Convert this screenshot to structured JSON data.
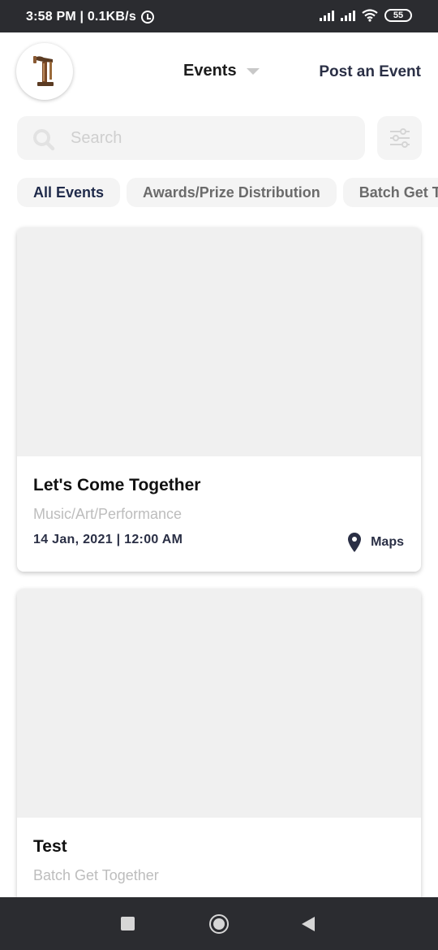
{
  "status_bar": {
    "time_speed": "3:58 PM | 0.1KB/s",
    "battery": "55"
  },
  "header": {
    "title": "Events",
    "post_link": "Post an Event",
    "logo_icon": "hammer-stand-logo"
  },
  "search": {
    "placeholder": "Search",
    "value": ""
  },
  "categories": [
    "All Events",
    "Awards/Prize Distribution",
    "Batch Get Together"
  ],
  "events": [
    {
      "title": "Let's Come Together",
      "category": "Music/Art/Performance",
      "datetime": "14 Jan, 2021 | 12:00 AM",
      "maps_label": "Maps"
    },
    {
      "title": "Test",
      "category": "Batch Get Together"
    }
  ],
  "colors": {
    "accent": "#2a2f45",
    "placeholder_gray": "#f0f0f0",
    "system_bar": "#2b2c30"
  }
}
